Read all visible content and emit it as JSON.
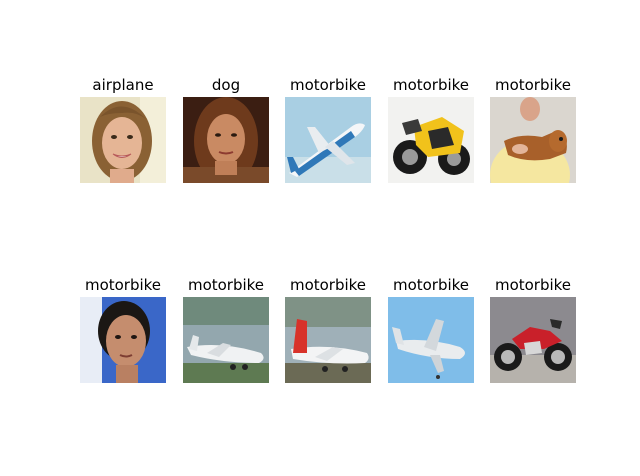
{
  "grid": {
    "rows": 2,
    "cols": 5,
    "panels": [
      {
        "label": "airplane",
        "depicts": "woman-face"
      },
      {
        "label": "dog",
        "depicts": "woman-face"
      },
      {
        "label": "motorbike",
        "depicts": "airplane"
      },
      {
        "label": "motorbike",
        "depicts": "motorbike"
      },
      {
        "label": "motorbike",
        "depicts": "person-with-dog"
      },
      {
        "label": "motorbike",
        "depicts": "woman-face"
      },
      {
        "label": "motorbike",
        "depicts": "airplane"
      },
      {
        "label": "motorbike",
        "depicts": "airplane"
      },
      {
        "label": "motorbike",
        "depicts": "airplane"
      },
      {
        "label": "motorbike",
        "depicts": "motorbike"
      }
    ]
  }
}
